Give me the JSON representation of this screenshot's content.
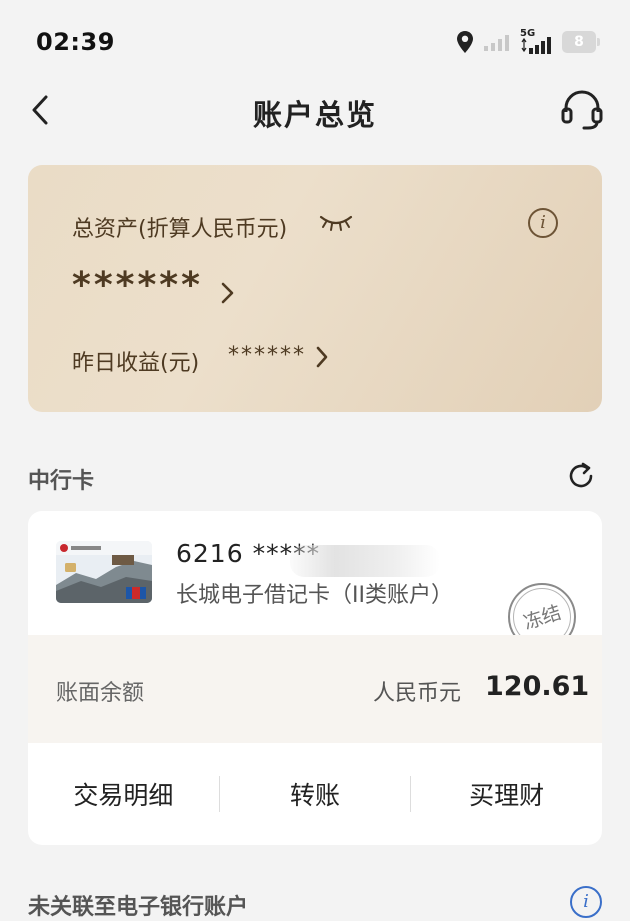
{
  "status_bar": {
    "time": "02:39",
    "network": "5G",
    "battery": "8",
    "icons": [
      "location-icon",
      "signal-weak-icon",
      "signal-5g-icon",
      "battery-icon"
    ]
  },
  "nav": {
    "title": "账户总览",
    "back_icon": "chevron-left-icon",
    "support_icon": "headset-icon"
  },
  "asset_card": {
    "label": "总资产(折算人民币元)",
    "value": "******",
    "yesterday_label": "昨日收益(元)",
    "yesterday_value": "******",
    "info_glyph": "i",
    "eye_icon": "eye-closed-icon"
  },
  "section": {
    "title": "中行卡",
    "refresh_icon": "refresh-icon"
  },
  "account": {
    "card_number": "6216 *****",
    "card_type": "长城电子借记卡（II类账户）",
    "status_stamp": "冻结",
    "balance_label": "账面余额",
    "currency": "人民币元",
    "balance": "120.61",
    "actions": [
      "交易明细",
      "转账",
      "买理财"
    ]
  },
  "bottom": {
    "title": "未关联至电子银行账户",
    "info_glyph": "i"
  },
  "colors": {
    "card_gold": "#e8dac4",
    "gold_text": "#4e3a22",
    "link_blue": "#3a6fc9"
  }
}
